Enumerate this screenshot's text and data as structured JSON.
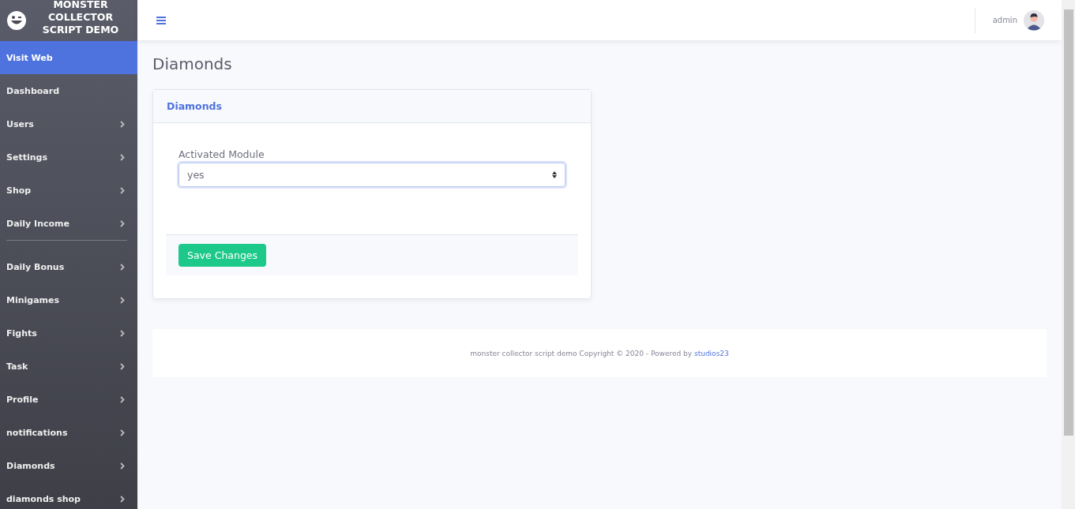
{
  "brand": {
    "title": "MONSTER COLLECTOR SCRIPT DEMO"
  },
  "sidebar": {
    "groups": [
      [
        {
          "label": "Visit Web",
          "selected": true,
          "has_submenu": false
        },
        {
          "label": "Dashboard",
          "selected": false,
          "has_submenu": false
        },
        {
          "label": "Users",
          "selected": false,
          "has_submenu": true
        },
        {
          "label": "Settings",
          "selected": false,
          "has_submenu": true
        },
        {
          "label": "Shop",
          "selected": false,
          "has_submenu": true
        },
        {
          "label": "Daily Income",
          "selected": false,
          "has_submenu": true
        }
      ],
      [
        {
          "label": "Daily Bonus",
          "selected": false,
          "has_submenu": true
        },
        {
          "label": "Minigames",
          "selected": false,
          "has_submenu": true
        },
        {
          "label": "Fights",
          "selected": false,
          "has_submenu": true
        },
        {
          "label": "Task",
          "selected": false,
          "has_submenu": true
        },
        {
          "label": "Profile",
          "selected": false,
          "has_submenu": true
        },
        {
          "label": "notifications",
          "selected": false,
          "has_submenu": true
        },
        {
          "label": "Diamonds",
          "selected": false,
          "has_submenu": true
        },
        {
          "label": "diamonds shop",
          "selected": false,
          "has_submenu": true
        }
      ]
    ]
  },
  "topbar": {
    "user": "admin"
  },
  "page": {
    "title": "Diamonds"
  },
  "card": {
    "title": "Diamonds",
    "field": {
      "label": "Activated Module",
      "value": "yes"
    },
    "button": "Save Changes"
  },
  "footer": {
    "text": "monster collector script demo Copyright © 2020 - Powered by",
    "link": "studios23"
  }
}
